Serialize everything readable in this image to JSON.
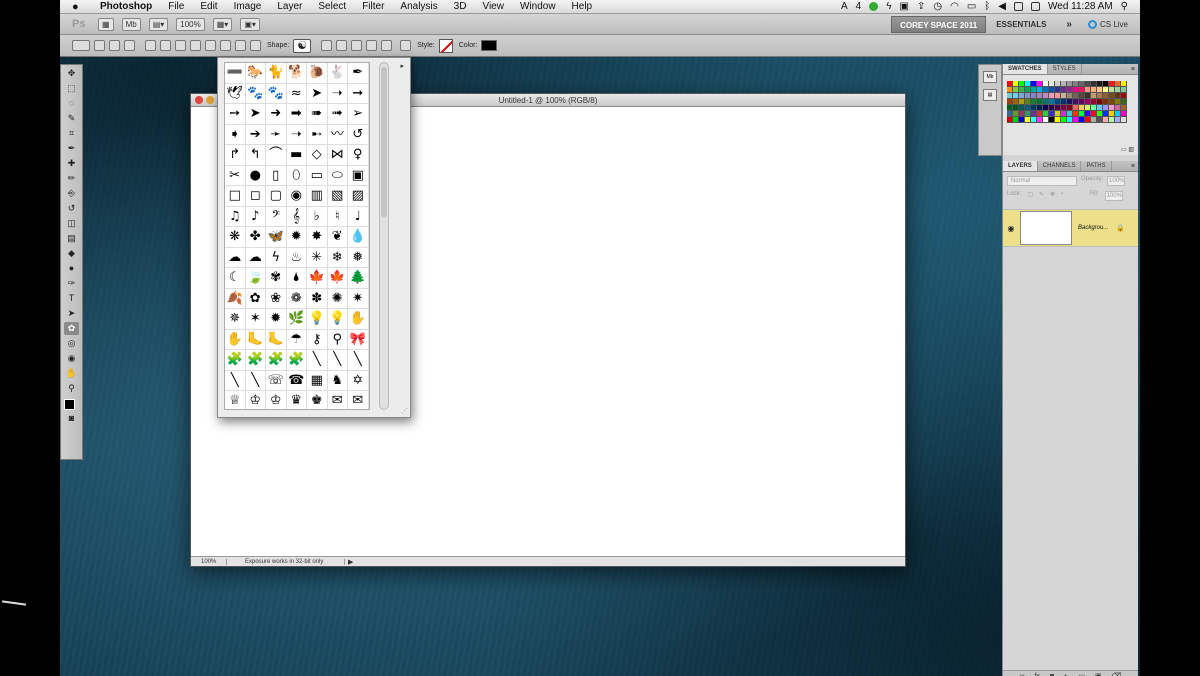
{
  "menubar": {
    "apple": "",
    "app_name": "Photoshop",
    "items": [
      "File",
      "Edit",
      "Image",
      "Layer",
      "Select",
      "Filter",
      "Analysis",
      "3D",
      "View",
      "Window",
      "Help"
    ],
    "status_a": "4",
    "clock": "Wed 11:28 AM"
  },
  "appbar": {
    "logo": "Ps",
    "zoom": "100%",
    "workspace_custom": "COREY SPACE 2011",
    "workspace_essentials": "ESSENTIALS",
    "more": "»",
    "cs_live": "CS Live"
  },
  "optbar": {
    "shape_label": "Shape:",
    "style_label": "Style:",
    "color_label": "Color:",
    "color_value": "#000000"
  },
  "tools": {
    "icons": [
      "move-icon",
      "marquee-icon",
      "lasso-icon",
      "quick-select-icon",
      "crop-icon",
      "eyedropper-icon",
      "healing-brush-icon",
      "brush-icon",
      "clone-stamp-icon",
      "history-brush-icon",
      "eraser-icon",
      "gradient-icon",
      "blur-icon",
      "dodge-icon",
      "pen-icon",
      "type-icon",
      "path-select-icon",
      "custom-shape-icon",
      "3d-rotate-icon",
      "3d-orbit-icon",
      "hand-icon",
      "zoom-icon"
    ],
    "glyphs": [
      "✥",
      "⬚",
      "◌",
      "✎",
      "⌗",
      "✒",
      "✚",
      "✏",
      "⎆",
      "↺",
      "◫",
      "▤",
      "◆",
      "●",
      "✑",
      "T",
      "➤",
      "✿",
      "◎",
      "◉",
      "✋",
      "⚲"
    ]
  },
  "document": {
    "title": "Untitled-1 @ 100% (RGB/8)",
    "zoom": "100%",
    "status": "Exposure works in 32-bit only"
  },
  "shape_picker": {
    "shapes": [
      "➖",
      "🐎",
      "🐈",
      "🐕",
      "🐌",
      "🐇",
      "✒",
      "🕊",
      "🐾",
      "🐾",
      "≈",
      "➤",
      "➝",
      "➞",
      "➙",
      "➤",
      "➜",
      "➡",
      "➠",
      "➟",
      "➢",
      "➧",
      "➔",
      "➛",
      "➝",
      "➸",
      "〰",
      "↺",
      "↱",
      "↰",
      "⌒",
      "▬",
      "◇",
      "⋈",
      "♀",
      "✂",
      "●",
      "▯",
      "⬯",
      "▭",
      "⬭",
      "▣",
      "□",
      "◻",
      "▢",
      "◉",
      "▥",
      "▧",
      "▨",
      "♫",
      "♪",
      "𝄢",
      "𝄞",
      "♭",
      "♮",
      "♩",
      "❋",
      "✤",
      "🦋",
      "✹",
      "✸",
      "❦",
      "💧",
      "☁",
      "☁",
      "ϟ",
      "♨",
      "✳",
      "❄",
      "❅",
      "☾",
      "🍃",
      "✾",
      "🌢",
      "🍁",
      "🍁",
      "🌲",
      "🍂",
      "✿",
      "❀",
      "❁",
      "✽",
      "✺",
      "✷",
      "✵",
      "✶",
      "✹",
      "🌿",
      "💡",
      "💡",
      "✋",
      "✋",
      "🦶",
      "🦶",
      "☂",
      "⚷",
      "⚲",
      "🎀",
      "🧩",
      "🧩",
      "🧩",
      "🧩",
      "╲",
      "╲",
      "╲",
      "╲",
      "╲",
      "☏",
      "☎",
      "▦",
      "♞",
      "✡",
      "♕",
      "♔",
      "♔",
      "♛",
      "♚",
      "✉",
      "✉"
    ],
    "menu_arrow": "▸"
  },
  "panels": {
    "swatches_tab": "SWATCHES",
    "styles_tab": "STYLES",
    "layers_tab": "LAYERS",
    "channels_tab": "CHANNELS",
    "paths_tab": "PATHS",
    "blend_mode": "Normal",
    "opacity_label": "Opacity:",
    "opacity_value": "100%",
    "lock_label": "Lock:",
    "fill_label": "Fill:",
    "fill_value": "100%",
    "layer_name": "Backgrou...",
    "swatch_colors": [
      "#ff0000",
      "#ffff00",
      "#00ff00",
      "#00ffff",
      "#0000ff",
      "#ff00ff",
      "#ffffff",
      "#e6e6e6",
      "#cccccc",
      "#b3b3b3",
      "#999999",
      "#808080",
      "#666666",
      "#4d4d4d",
      "#333333",
      "#1a1a1a",
      "#000000",
      "#ed1c24",
      "#f26522",
      "#fff200",
      "#f7941d",
      "#8dc63f",
      "#39b54a",
      "#00a651",
      "#00a99d",
      "#00aeef",
      "#0072bc",
      "#0054a6",
      "#2e3192",
      "#662d91",
      "#92278f",
      "#ec008c",
      "#ed145b",
      "#f69679",
      "#f9ad81",
      "#fdc689",
      "#fff799",
      "#c4df9b",
      "#a3d39c",
      "#82ca9c",
      "#7accc8",
      "#6dcff6",
      "#7da7d9",
      "#8393ca",
      "#8781bd",
      "#a186be",
      "#bd8cbf",
      "#f49ac2",
      "#f6989d",
      "#c7b299",
      "#998675",
      "#736357",
      "#534741",
      "#37302a",
      "#c69c6d",
      "#a67c52",
      "#8c6239",
      "#754c24",
      "#603913",
      "#9e0b0f",
      "#a0410d",
      "#a36209",
      "#aba000",
      "#598527",
      "#197b30",
      "#007236",
      "#00746b",
      "#0076a3",
      "#004a80",
      "#003471",
      "#1b1464",
      "#440e62",
      "#630460",
      "#9e005d",
      "#9e0039",
      "#790000",
      "#7b2e00",
      "#7d4900",
      "#827b00",
      "#406618",
      "#005e20",
      "#005826",
      "#005952",
      "#005b7f",
      "#003663",
      "#002157",
      "#0d004c",
      "#32004b",
      "#4b0049",
      "#7b0046",
      "#7a0026",
      "#ff6666",
      "#ffcc66",
      "#ccff66",
      "#66ff99",
      "#66ccff",
      "#9999ff",
      "#ff99cc",
      "#cc6699",
      "#996633",
      "#336699",
      "#669933",
      "#993366",
      "#339966",
      "#663399",
      "#cc3333",
      "#33cc33",
      "#3333cc",
      "#cccc33",
      "#cc33cc",
      "#33cccc",
      "#ff3300",
      "#00ff33",
      "#3300ff",
      "#ff0033",
      "#33ff00",
      "#0033ff",
      "#ffcc00",
      "#00ccff",
      "#ff00cc",
      "#cc0000",
      "#00cc00",
      "#0000cc",
      "#ffff33",
      "#33ffff",
      "#ff33ff",
      "#ffffff",
      "#000000",
      "#ffff00",
      "#00ff00",
      "#00ffff",
      "#ff00ff",
      "#0000ff",
      "#ff0000",
      "#aaaaaa",
      "#555555",
      "#ffaaaa",
      "#aaffaa",
      "#aaaaff",
      "#dddddd"
    ]
  }
}
